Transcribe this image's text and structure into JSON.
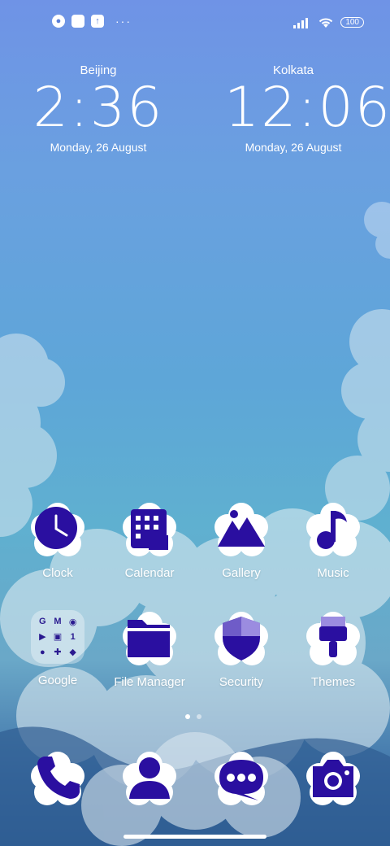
{
  "status_bar": {
    "left_icons": [
      "notification-app-icon",
      "square-notification-icon",
      "upload-icon"
    ],
    "more": "···",
    "battery": "100"
  },
  "clocks": [
    {
      "city": "Beijing",
      "time": "2:36",
      "date": "Monday, 26 August"
    },
    {
      "city": "Kolkata",
      "time": "12:06",
      "date": "Monday, 26 August"
    }
  ],
  "apps_row1": [
    {
      "label": "Clock",
      "icon": "clock-icon"
    },
    {
      "label": "Calendar",
      "icon": "calendar-icon"
    },
    {
      "label": "Gallery",
      "icon": "gallery-icon"
    },
    {
      "label": "Music",
      "icon": "music-icon"
    }
  ],
  "apps_row2": [
    {
      "label": "Google",
      "icon": "google-folder-icon",
      "folder_glyphs": [
        "G",
        "M",
        "📍",
        "▶",
        "M",
        "1",
        "●",
        "✚",
        "◆"
      ]
    },
    {
      "label": "File Manager",
      "icon": "folder-icon"
    },
    {
      "label": "Security",
      "icon": "shield-icon"
    },
    {
      "label": "Themes",
      "icon": "paint-brush-icon"
    }
  ],
  "dock": [
    {
      "icon": "phone-icon"
    },
    {
      "icon": "contacts-icon"
    },
    {
      "icon": "messages-icon"
    },
    {
      "icon": "camera-icon"
    }
  ],
  "page_indicator": {
    "count": 2,
    "active": 1
  },
  "colors": {
    "icon_fg": "#2a0fa0",
    "icon_bg": "#ffffff"
  }
}
